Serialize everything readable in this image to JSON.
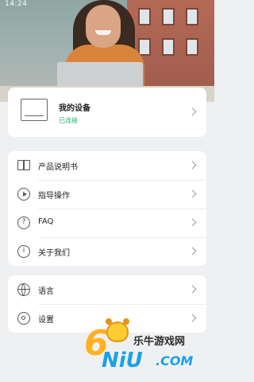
{
  "status_bar": {
    "time": "14:24"
  },
  "device": {
    "title": "我的设备",
    "status": "已连接"
  },
  "menu": [
    {
      "label": "产品说明书",
      "icon": "manual-book-icon"
    },
    {
      "label": "指导操作",
      "icon": "play-guide-icon"
    },
    {
      "label": "FAQ",
      "icon": "question-icon"
    },
    {
      "label": "关于我们",
      "icon": "info-icon"
    }
  ],
  "menu2": [
    {
      "label": "语言",
      "icon": "globe-icon"
    },
    {
      "label": "设置",
      "icon": "gear-icon"
    }
  ],
  "watermark": {
    "cn": "乐牛游戏网",
    "brand": "NiU",
    "domain": ".COM",
    "digit": "6"
  },
  "colors": {
    "accent_green": "#27b36b",
    "brand_orange": "#ffb11f",
    "brand_blue": "#1aa1e6"
  }
}
